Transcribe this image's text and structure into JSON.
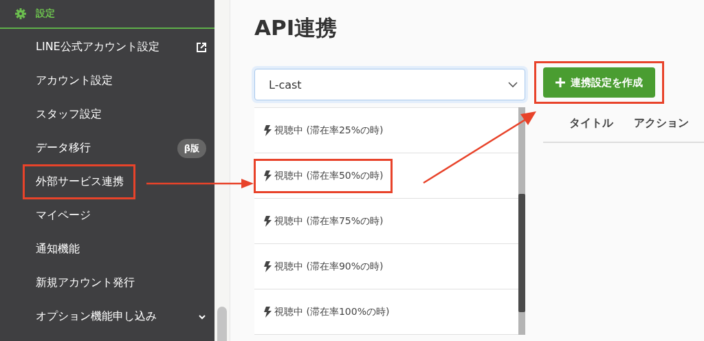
{
  "sidebar": {
    "section": {
      "label": "設定"
    },
    "items": [
      {
        "label": "LINE公式アカウント設定",
        "kind": "external",
        "annotated": false
      },
      {
        "label": "アカウント設定",
        "kind": "plain",
        "annotated": false
      },
      {
        "label": "スタッフ設定",
        "kind": "plain",
        "annotated": false
      },
      {
        "label": "データ移行",
        "kind": "badge",
        "badge": "β版",
        "annotated": false
      },
      {
        "label": "外部サービス連携",
        "kind": "plain",
        "annotated": true
      },
      {
        "label": "マイページ",
        "kind": "plain",
        "annotated": false
      },
      {
        "label": "通知機能",
        "kind": "plain",
        "annotated": false
      },
      {
        "label": "新規アカウント発行",
        "kind": "plain",
        "annotated": false
      },
      {
        "label": "オプション機能申し込み",
        "kind": "expand",
        "annotated": false
      }
    ]
  },
  "main": {
    "title": "API連携",
    "select": {
      "value": "L-cast"
    },
    "options": [
      {
        "label": "視聴中 (滞在率25%の時)",
        "annotated": false
      },
      {
        "label": "視聴中 (滞在率50%の時)",
        "annotated": true
      },
      {
        "label": "視聴中 (滞在率75%の時)",
        "annotated": false
      },
      {
        "label": "視聴中 (滞在率90%の時)",
        "annotated": false
      },
      {
        "label": "視聴中 (滞在率100%の時)",
        "annotated": false
      }
    ],
    "create_button": {
      "label": "連携設定を作成",
      "annotated": true
    },
    "table": {
      "columns": [
        "タイトル",
        "アクション"
      ]
    }
  }
}
